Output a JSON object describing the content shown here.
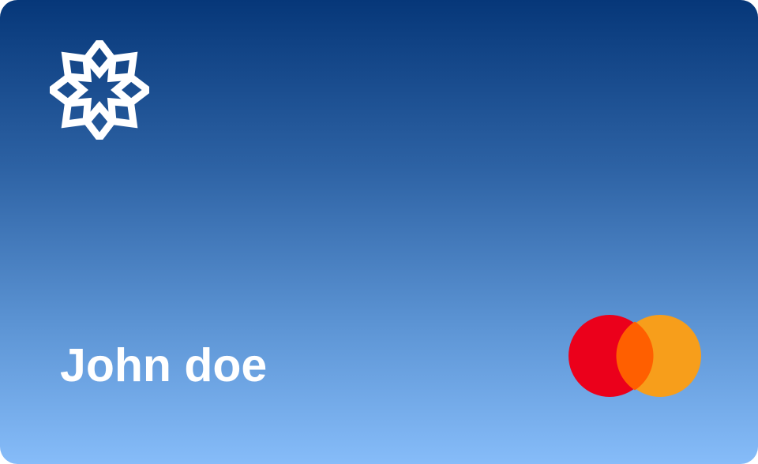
{
  "card": {
    "holder_name": "John doe",
    "brand_icon": "eight-petal-flower-icon",
    "network_icon": "mastercard-logo-icon",
    "colors": {
      "gradient_top": "#063779",
      "gradient_bottom": "#86bcf9",
      "text": "#ffffff",
      "mastercard_red": "#eb001b",
      "mastercard_orange": "#f79e1b",
      "mastercard_overlap": "#ff5f00"
    }
  }
}
